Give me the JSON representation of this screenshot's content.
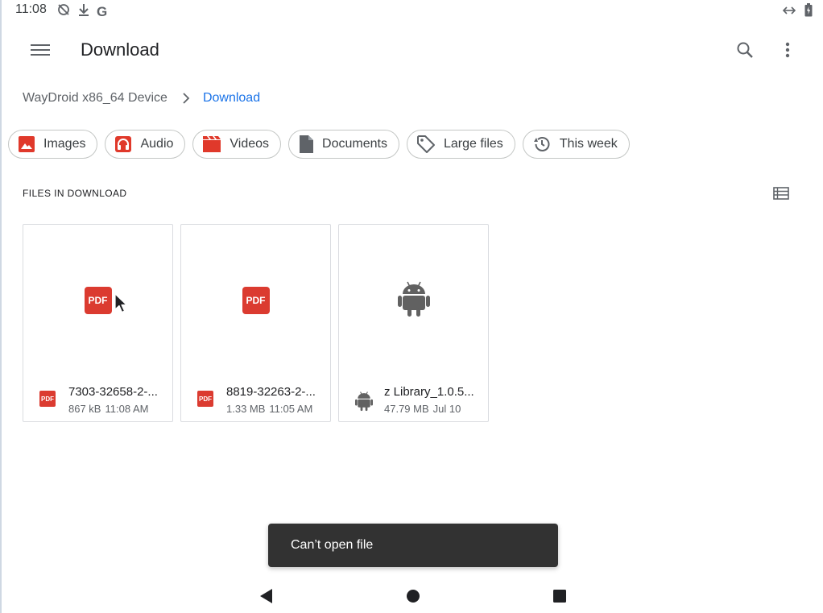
{
  "status_bar": {
    "time": "11:08",
    "icons_left": [
      "sync-disabled-icon",
      "download-icon",
      "google-icon"
    ],
    "google_letter": "G",
    "icons_right": [
      "link-arrows-icon",
      "battery-icon"
    ]
  },
  "toolbar": {
    "title": "Download",
    "menu_icon": "hamburger-menu-icon",
    "search_icon": "search-icon",
    "more_icon": "more-vert-icon"
  },
  "breadcrumb": {
    "root": "WayDroid x86_64 Device",
    "current": "Download"
  },
  "chips": [
    {
      "label": "Images",
      "icon": "image-icon",
      "color": "#e0392b"
    },
    {
      "label": "Audio",
      "icon": "headphones-icon",
      "color": "#e0392b"
    },
    {
      "label": "Videos",
      "icon": "video-icon",
      "color": "#e0392b"
    },
    {
      "label": "Documents",
      "icon": "document-icon",
      "color": "#5f6368"
    },
    {
      "label": "Large files",
      "icon": "tag-icon",
      "color": "#5f6368"
    },
    {
      "label": "This week",
      "icon": "history-icon",
      "color": "#5f6368"
    }
  ],
  "section": {
    "title": "FILES IN DOWNLOAD",
    "view_toggle_icon": "list-view-icon"
  },
  "files": [
    {
      "name": "7303-32658-2-...",
      "size": "867 kB",
      "date": "11:08 AM",
      "type": "pdf",
      "badge": "PDF"
    },
    {
      "name": "8819-32263-2-...",
      "size": "1.33 MB",
      "date": "11:05 AM",
      "type": "pdf",
      "badge": "PDF"
    },
    {
      "name": "z Library_1.0.5...",
      "size": "47.79 MB",
      "date": "Jul 10",
      "type": "apk",
      "badge": ""
    }
  ],
  "snackbar": {
    "message": "Can’t open file"
  },
  "nav_bar": {
    "back_icon": "back-triangle-icon",
    "home_icon": "home-circle-icon",
    "recents_icon": "recents-square-icon"
  },
  "colors": {
    "accent": "#1a73e8",
    "pdf_red": "#db3b30",
    "snackbar_bg": "#323232",
    "android_gray": "#616161"
  }
}
